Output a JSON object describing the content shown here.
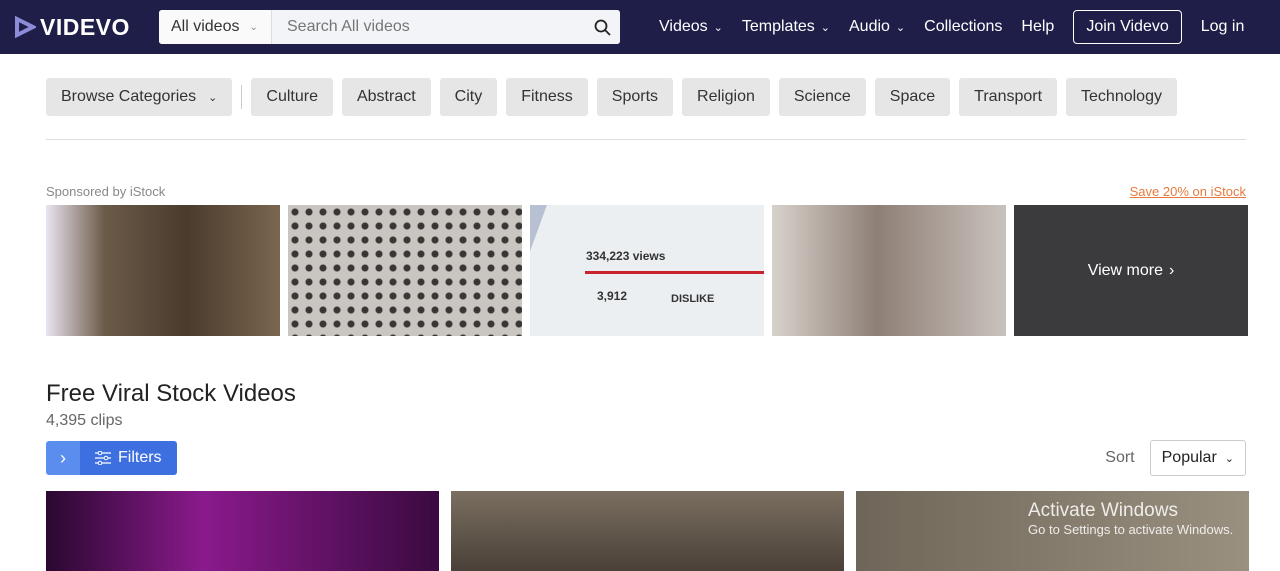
{
  "header": {
    "logo": "VIDEVO",
    "search_scope": "All videos",
    "search_placeholder": "Search All videos",
    "nav": [
      "Videos",
      "Templates",
      "Audio"
    ],
    "collections": "Collections",
    "help": "Help",
    "join": "Join Videvo",
    "login": "Log in"
  },
  "categories": {
    "browse": "Browse Categories",
    "items": [
      "Culture",
      "Abstract",
      "City",
      "Fitness",
      "Sports",
      "Religion",
      "Science",
      "Space",
      "Transport",
      "Technology"
    ]
  },
  "sponsored": {
    "label": "Sponsored by iStock",
    "promo": "Save 20% on iStock",
    "view_more": "View more",
    "thumb3": {
      "views": "334,223 views",
      "likes": "3,912",
      "dislike": "DISLIKE"
    }
  },
  "main": {
    "title": "Free Viral Stock Videos",
    "clips": "4,395 clips",
    "filters": "Filters",
    "sort_label": "Sort",
    "sort_value": "Popular"
  },
  "watermark": {
    "title": "Activate Windows",
    "sub": "Go to Settings to activate Windows."
  }
}
